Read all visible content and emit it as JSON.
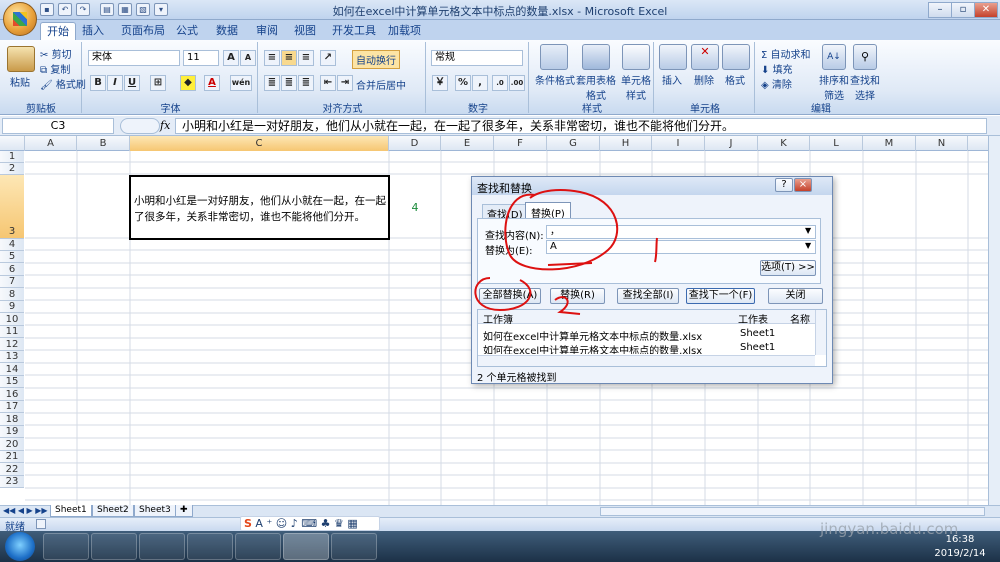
{
  "window": {
    "title": "如何在excel中计算单元格文本中标点的数量.xlsx - Microsoft Excel"
  },
  "tabs": [
    "开始",
    "插入",
    "页面布局",
    "公式",
    "数据",
    "审阅",
    "视图",
    "开发工具",
    "加载项"
  ],
  "clipboard": {
    "paste": "粘贴",
    "cut": "剪切",
    "copy": "复制",
    "format_painter": "格式刷",
    "label": "剪贴板"
  },
  "font": {
    "name": "宋体",
    "size": "11",
    "bold": "B",
    "italic": "I",
    "underline": "U",
    "label": "字体",
    "color_a": "A",
    "grow": "A",
    "shrink": "A",
    "wen": "wén"
  },
  "alignment": {
    "wrap": "自动换行",
    "merge": "合并后居中",
    "label": "对齐方式"
  },
  "number": {
    "format": "常规",
    "currency": "￥",
    "percent": "%",
    "comma": ",",
    "inc": ".0",
    "dec": ".00",
    "label": "数字"
  },
  "styles": {
    "conditional": "条件格式",
    "table": "套用表格格式",
    "cell": "单元格样式",
    "label": "样式"
  },
  "cells": {
    "insert": "插入",
    "delete": "删除",
    "format": "格式",
    "label": "单元格"
  },
  "editing": {
    "autosum": "Σ 自动求和",
    "fill": "填充",
    "clear": "清除",
    "sort": "排序和筛选",
    "find": "查找和选择",
    "label": "编辑"
  },
  "formula_bar": {
    "name_box": "C3",
    "fx": "fx",
    "content": "小明和小红是一对好朋友，他们从小就在一起，在一起了很多年，关系非常密切，谁也不能将他们分开。"
  },
  "columns": [
    "A",
    "B",
    "C",
    "D",
    "E",
    "F",
    "G",
    "H",
    "I",
    "J",
    "K",
    "L",
    "M",
    "N"
  ],
  "rows": [
    "1",
    "2",
    "3",
    "4",
    "5",
    "6",
    "7",
    "8",
    "9",
    "10",
    "11",
    "12",
    "13",
    "14",
    "15",
    "16",
    "17",
    "18",
    "19",
    "20",
    "21",
    "22",
    "23"
  ],
  "cell_C3": "小明和小红是一对好朋友，他们从小就在一起，在一起了很多年，关系非常密切，谁也不能将他们分开。",
  "cell_D3": "4",
  "sheets": [
    "Sheet1",
    "Sheet2",
    "Sheet3"
  ],
  "status": {
    "ready": "就绪"
  },
  "dialog": {
    "title": "查找和替换",
    "help": "?",
    "close": "×",
    "tab_find": "查找(D)",
    "tab_replace": "替换(P)",
    "find_label": "查找内容(N):",
    "find_value": "，",
    "replace_label": "替换为(E):",
    "replace_value": "A",
    "options": "选项(T) >>",
    "btn_replace_all": "全部替换(A)",
    "btn_replace": "替换(R)",
    "btn_find_all": "查找全部(I)",
    "btn_find_next": "查找下一个(F)",
    "btn_close": "关闭",
    "results_headers": [
      "工作簿",
      "工作表",
      "名称"
    ],
    "results": [
      [
        "如何在excel中计算单元格文本中标点的数量.xlsx",
        "Sheet1"
      ],
      [
        "如何在excel中计算单元格文本中标点的数量.xlsx",
        "Sheet1"
      ]
    ],
    "status": "2 个单元格被找到"
  },
  "taskbar": {
    "time": "16:38",
    "date": "2019/2/14"
  },
  "watermark": {
    "text": "jingyan.baidu.com"
  }
}
